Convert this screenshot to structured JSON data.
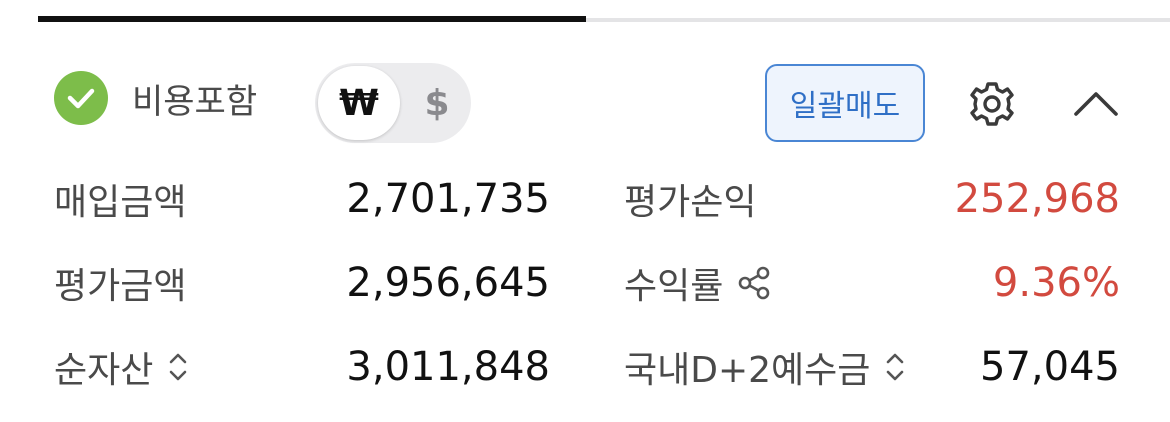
{
  "header": {
    "fee_label": "비용포함",
    "currency_selected": "₩",
    "currency_other": "$",
    "bulk_sell_label": "일괄매도"
  },
  "stats": {
    "purchase_amount": {
      "label": "매입금액",
      "value": "2,701,735"
    },
    "valuation_amount": {
      "label": "평가금액",
      "value": "2,956,645"
    },
    "net_assets": {
      "label": "순자산",
      "value": "3,011,848"
    },
    "valuation_pl": {
      "label": "평가손익",
      "value": "252,968"
    },
    "return_rate": {
      "label": "수익률",
      "value": "9.36%"
    },
    "domestic_d2_deposit": {
      "label": "국내D+2예수금",
      "value": "57,045"
    }
  },
  "colors": {
    "check_green": "#7dbd4a",
    "accent_blue": "#2f6fc6",
    "positive_red": "#d24a3f"
  },
  "icons": {
    "fee_checked": "check-circle-icon",
    "settings": "gear-icon",
    "collapse": "chevron-up-icon",
    "share": "share-icon",
    "sort": "sort-toggle-icon"
  }
}
